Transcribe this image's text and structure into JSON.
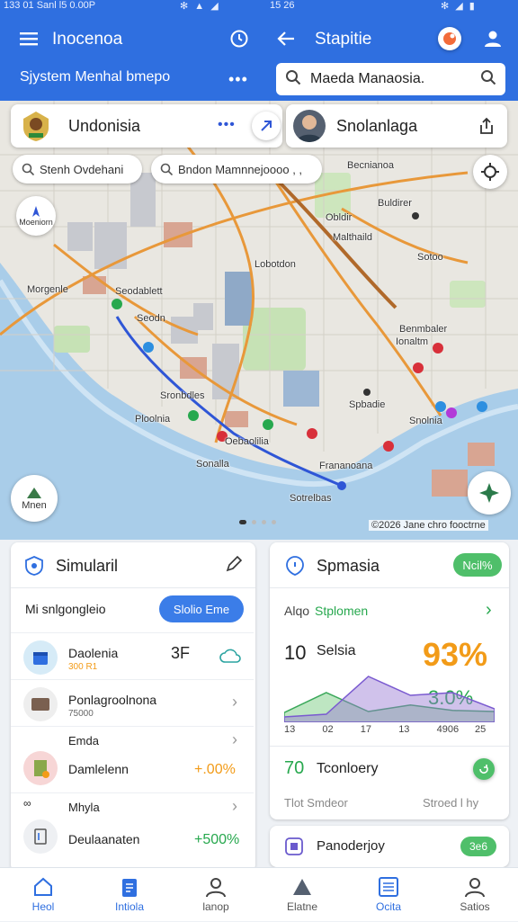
{
  "status_bar": {
    "left": "133 01 Sanl l5 0.00P",
    "time": "15 26"
  },
  "header": {
    "left_title": "Inocenoa",
    "right_title": "Stapitie",
    "subtitle": "Sjystem Menhal bmepo",
    "search_value": "Maeda Manaosia.",
    "accent": "#2f6fe0"
  },
  "map_card_left": {
    "title": "Undonisia"
  },
  "map_card_right": {
    "title": "Snolanlaga"
  },
  "filter_pills": [
    "Stenh Ovdehani",
    "Bndon Mamnnejoooo , ,"
  ],
  "map_labels": [
    "Becnianoa",
    "Buldirer",
    "Obldir",
    "Malthaild",
    "Sotoo",
    "Benmbaler",
    "Morgenle",
    "Seodablett",
    "Seodn",
    "Sronbdles",
    "Spbadie",
    "Ploolnia",
    "Oebaolilia",
    "Sonalla",
    "Frananoana",
    "Sotrelbas",
    "Lobotdon",
    "Snolnia",
    "Ionaltm"
  ],
  "map_attribution": "©2026 Jane chro fooctrne",
  "map_buttons": {
    "left_fab": "Mnen",
    "top_left": "Moeniorn"
  },
  "left_panel": {
    "title": "Simularil",
    "subtitle": "Mi snlgongleio",
    "action_button": "Slolio Eme",
    "rows": [
      {
        "name": "Daolenia",
        "sub": "300 R1",
        "value": "3F",
        "icon": "calendar-icon"
      },
      {
        "name": "Ponlagroolnona",
        "sub": "75000",
        "value": "",
        "icon": "wallet-icon"
      },
      {
        "name": "Emda",
        "sub": "",
        "value": "",
        "icon": ""
      },
      {
        "name": "Damlelenn",
        "sub": "",
        "value": "+.00%",
        "icon": "book-icon"
      },
      {
        "name": "Mhyla",
        "sub": "",
        "value": "",
        "icon": ""
      },
      {
        "name": "Deulaanaten",
        "sub": "",
        "value": "+500%",
        "icon": "doc-icon"
      }
    ]
  },
  "right_panel": {
    "title": "Spmasia",
    "badge": "Ncil%",
    "link_prefix": "Alqo",
    "link_text": "Stplomen",
    "big_number": "10",
    "big_label": "Selsia",
    "percent_main": "93%",
    "percent_sub": "3.0%",
    "axis_labels": [
      "13",
      "02",
      "17",
      "13",
      "4906",
      "25"
    ],
    "stat_number": "70",
    "stat_label": "Tconloery",
    "footer_left": "Tlot Smdeor",
    "footer_right": "Stroed l hy",
    "bottom_item": "Panoderjoy",
    "bottom_badge": "3e6",
    "colors": {
      "green": "#27a84e",
      "orange": "#f29b18"
    }
  },
  "nav": [
    {
      "label": "Heol",
      "icon": "home-icon"
    },
    {
      "label": "Intiola",
      "icon": "clipboard-icon"
    },
    {
      "label": "lanop",
      "icon": "user-icon"
    },
    {
      "label": "Elatne",
      "icon": "map-icon"
    },
    {
      "label": "Ocita",
      "icon": "list-icon"
    },
    {
      "label": "Satios",
      "icon": "person-icon"
    }
  ],
  "chart_data": {
    "type": "area",
    "x": [
      "13",
      "02",
      "17",
      "13",
      "4906",
      "25"
    ],
    "series": [
      {
        "values": [
          0.18,
          0.55,
          0.2,
          0.32,
          0.22,
          0.2
        ]
      },
      {
        "values": [
          0.1,
          0.15,
          0.85,
          0.5,
          0.55,
          0.25
        ]
      }
    ]
  }
}
